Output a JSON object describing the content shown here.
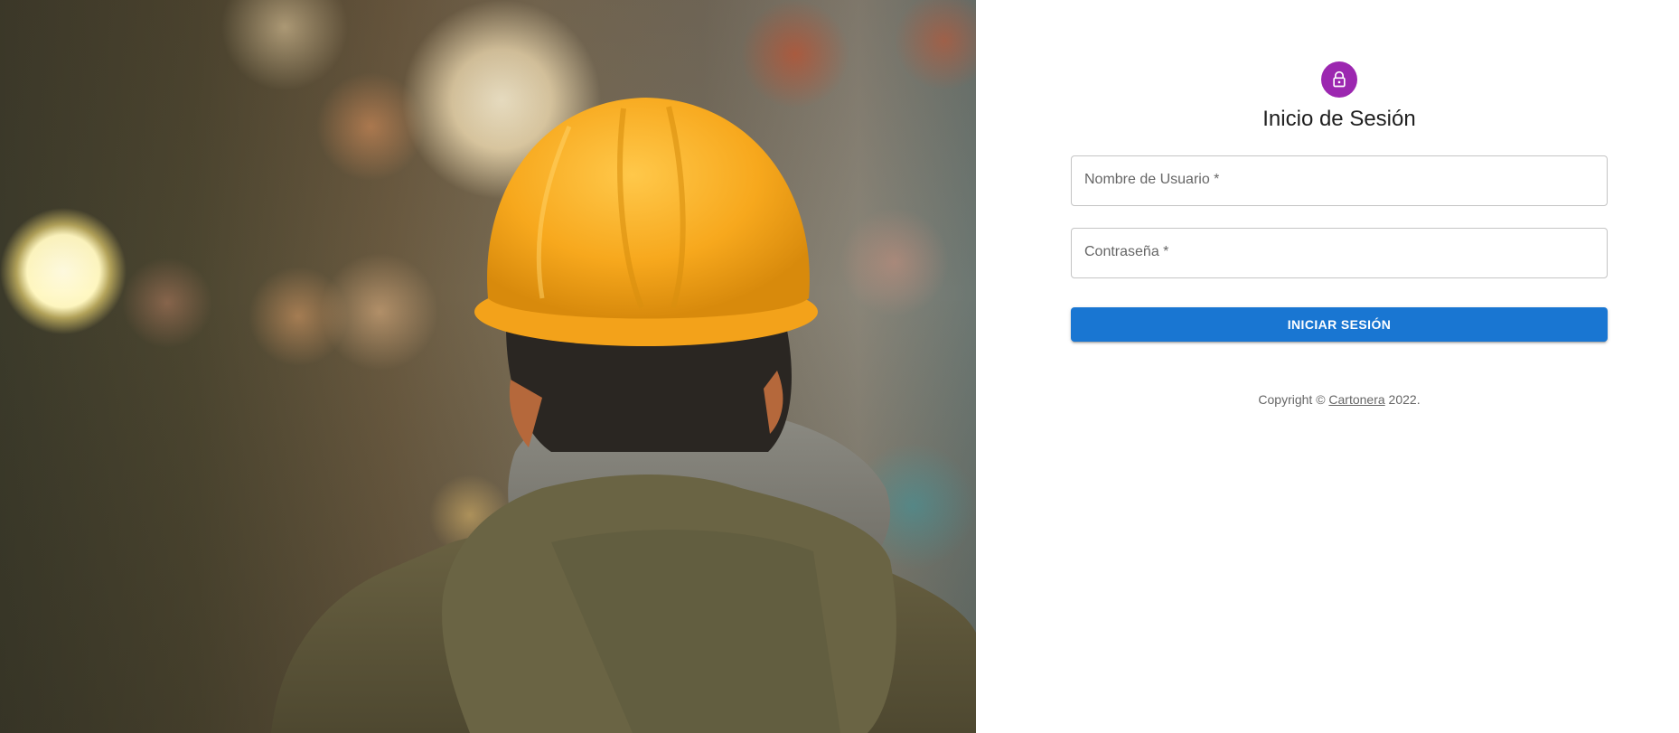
{
  "login": {
    "title": "Inicio de Sesión",
    "username_label": "Nombre de Usuario *",
    "password_label": "Contraseña *",
    "username_value": "",
    "password_value": "",
    "submit_label": "INICIAR SESIÓN",
    "icon": "lock-icon"
  },
  "footer": {
    "copyright_prefix": "Copyright © ",
    "brand_link": "Cartonera",
    "copyright_suffix": " 2022."
  },
  "colors": {
    "avatar": "#9c27b0",
    "primary_button": "#1976d2",
    "helmet": "#f5a623"
  }
}
